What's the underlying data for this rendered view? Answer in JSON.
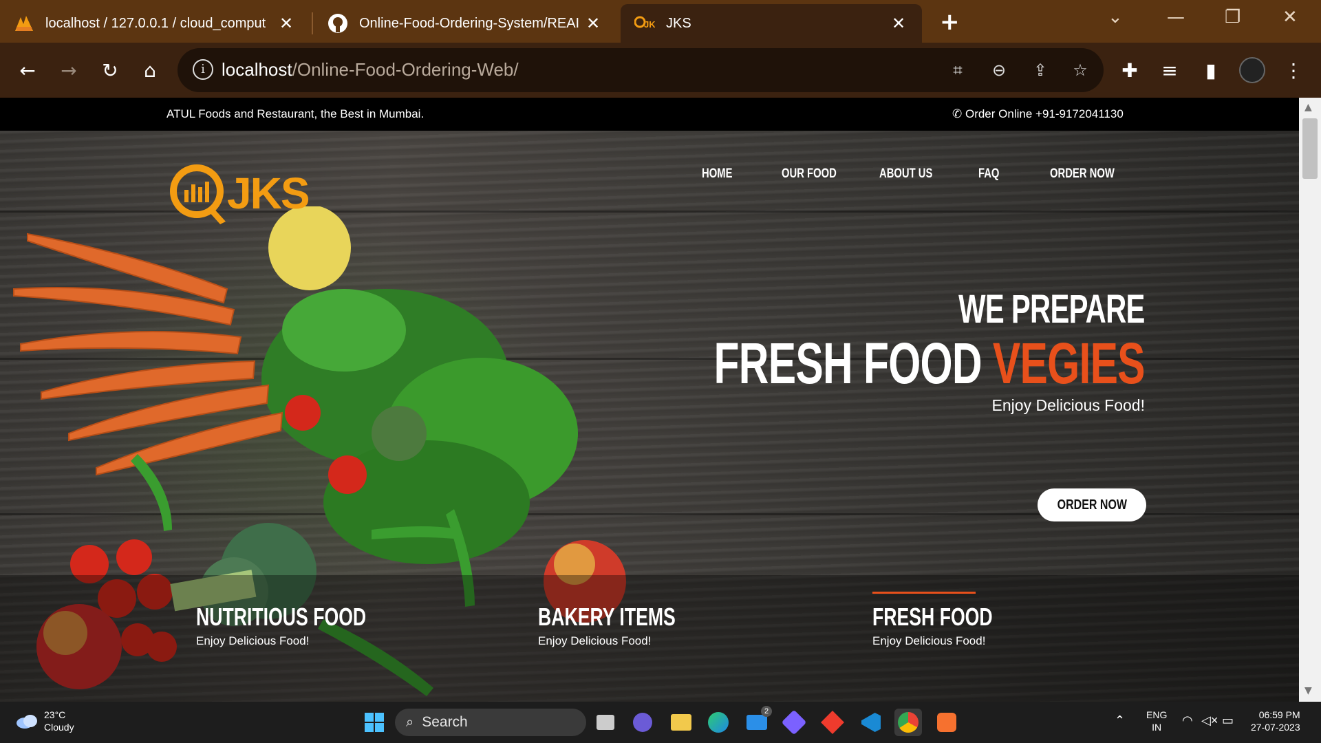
{
  "browser": {
    "tabs": [
      {
        "title": "localhost / 127.0.0.1 / cloud_comput",
        "favicon": "phpmyadmin-icon"
      },
      {
        "title": "Online-Food-Ordering-System/REAI",
        "favicon": "github-icon"
      },
      {
        "title": "JKS",
        "favicon": "jks-logo-icon",
        "active": true
      }
    ],
    "url_host": "localhost",
    "url_path": "/Online-Food-Ordering-Web/"
  },
  "site": {
    "topbar": {
      "tagline": "ATUL Foods and Restaurant, the Best in Mumbai.",
      "order_online": "Order Online +91-9172041130"
    },
    "logo_text": "JKS",
    "nav": [
      "HOME",
      "OUR FOOD",
      "ABOUT US",
      "FAQ",
      "ORDER NOW"
    ],
    "hero": {
      "line1": "WE PREPARE",
      "line2_main": "FRESH FOOD ",
      "line2_accent": "VEGIES",
      "line3": "Enjoy Delicious Food!",
      "button": "ORDER NOW"
    },
    "features": [
      {
        "title": "NUTRITIOUS FOOD",
        "subtitle": "Enjoy Delicious Food!"
      },
      {
        "title": "BAKERY ITEMS",
        "subtitle": "Enjoy Delicious Food!"
      },
      {
        "title": "FRESH FOOD",
        "subtitle": "Enjoy Delicious Food!"
      }
    ],
    "colors": {
      "accent": "#e8501b",
      "logo": "#f39c12"
    }
  },
  "taskbar": {
    "weather_temp": "23°C",
    "weather_desc": "Cloudy",
    "search_label": "Search",
    "mail_badge": "2",
    "lang_top": "ENG",
    "lang_bottom": "IN",
    "time": "06:59 PM",
    "date": "27-07-2023"
  }
}
